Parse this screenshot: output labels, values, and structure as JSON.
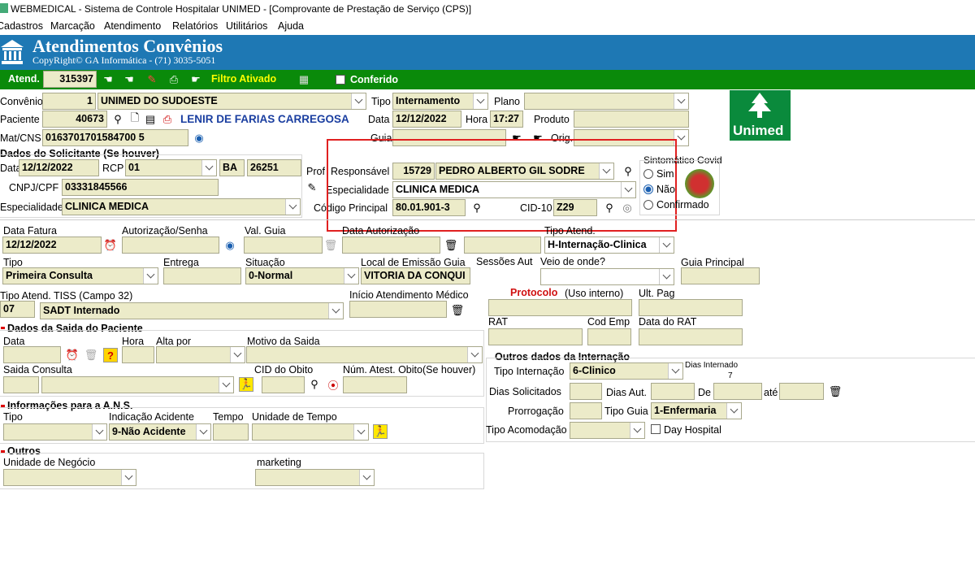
{
  "titlebar": {
    "title": "WEBMEDICAL - Sistema de Controle Hospitalar UNIMED - [Comprovante de Prestação de Serviço  (CPS)]"
  },
  "menu": [
    "Cadastros",
    "Marcação",
    "Atendimento",
    "Relatórios",
    "Utilitários",
    "Ajuda"
  ],
  "header": {
    "title": "Atendimentos Convênios",
    "copyright": "CopyRight© GA Informática - (71) 3035-5051",
    "bg": "#1e78b4"
  },
  "toolbar": {
    "atend_label": "Atend.",
    "atend_value": "315397",
    "filtro": "Filtro Ativado",
    "conferido": "Conferido",
    "bg": "#0a8a0a",
    "filtro_color": "#ffff00"
  },
  "patient": {
    "convenio_label": "Convênio",
    "convenio_code": "1",
    "convenio_name": "UNIMED DO SUDOESTE",
    "tipo_label": "Tipo",
    "tipo_value": "Internamento",
    "plano_label": "Plano",
    "paciente_label": "Paciente",
    "paciente_code": "40673",
    "paciente_name": "LENIR DE FARIAS CARREGOSA",
    "data_label": "Data",
    "data_value": "12/12/2022",
    "hora_label": "Hora",
    "hora_value": "17:27",
    "produto_label": "Produto",
    "matcns_label": "Mat/CNS",
    "matcns_value": "0163701701584700 5",
    "guia_label": "Guia",
    "orig_label": "Orig."
  },
  "solicitante": {
    "section": "Dados do Solicitante (Se houver)",
    "data_label": "Data",
    "data_value": "12/12/2022",
    "rcp_label": "RCP",
    "rcp_value": "01",
    "uf": "BA",
    "num": "26251",
    "cnpj_label": "CNPJ/CPF",
    "cnpj_value": "03331845566",
    "esp_label": "Especialidade",
    "esp_value": "CLINICA MEDICA"
  },
  "profissional": {
    "prof_label": "Prof",
    "resp_label": "Responsável",
    "resp_code": "15729",
    "resp_name": "PEDRO ALBERTO GIL SODRE",
    "esp_label": "Especialidade",
    "esp_value": "CLINICA MEDICA",
    "cod_label": "Código Principal",
    "cod_value": "80.01.901-3",
    "cid_label": "CID-10",
    "cid_value": "Z29"
  },
  "covid": {
    "title": "Sintomático Covid",
    "opts": [
      "Sim",
      "Não",
      "Confirmado"
    ],
    "selected": "Não"
  },
  "fatura": {
    "data_fatura_label": "Data Fatura",
    "data_fatura_value": "12/12/2022",
    "autorizacao_label": "Autorização/Senha",
    "val_guia_label": "Val. Guia",
    "data_aut_label": "Data Autorização",
    "tipo_atend_label": "Tipo Atend.",
    "tipo_atend_value": "H-Internação-Clinica",
    "tipo_label": "Tipo",
    "tipo_value": "Primeira Consulta",
    "entrega_label": "Entrega",
    "situacao_label": "Situação",
    "situacao_value": "0-Normal",
    "local_label": "Local de Emissão Guia",
    "local_value": "VITORIA DA CONQUI",
    "sessoes_label": "Sessões Aut",
    "veio_label": "Veio de onde?",
    "guia_principal_label": "Guia Principal",
    "tiss_label": "Tipo Atend. TISS (Campo 32)",
    "tiss_code": "07",
    "tiss_value": "SADT Internado",
    "inicio_label": "Início Atendimento Médico",
    "protocolo_label": "Protocolo",
    "protocolo_note": "(Uso interno)",
    "ult_pag_label": "Ult. Pag",
    "rat_label": "RAT",
    "cod_emp_label": "Cod Emp",
    "data_rat_label": "Data do RAT"
  },
  "saida": {
    "section": "Dados da Saida do Paciente",
    "data_label": "Data",
    "hora_label": "Hora",
    "alta_label": "Alta por",
    "motivo_label": "Motivo da Saida",
    "consulta_label": "Saida Consulta",
    "cid_obito_label": "CID do Obito",
    "atest_label": "Núm. Atest. Obito(Se houver)"
  },
  "ans": {
    "section": "Informações para a A.N.S.",
    "tipo_label": "Tipo",
    "indicacao_label": "Indicação Acidente",
    "indicacao_value": "9-Não Acidente",
    "tempo_label": "Tempo",
    "unidade_label": "Unidade de Tempo"
  },
  "outros": {
    "section": "Outros",
    "unidade_label": "Unidade de Negócio",
    "marketing_label": "marketing"
  },
  "internacao": {
    "section": "Outros dados da Internação",
    "tipo_label": "Tipo Internação",
    "tipo_value": "6-Clinico",
    "dias_internado_label": "Dias Internado",
    "dias_internado_value": "7",
    "dias_sol_label": "Dias Solicitados",
    "dias_aut_label": "Dias Aut.",
    "de_label": "De",
    "ate_label": "até",
    "prorrogacao_label": "Prorrogação",
    "tipo_guia_label": "Tipo Guia",
    "tipo_guia_value": "1-Enfermaria",
    "acomodacao_label": "Tipo Acomodação",
    "day_hospital": "Day Hospital"
  },
  "logo": {
    "text": "Unimed",
    "color": "#0a8a3c"
  },
  "highlight_color": "#e02020"
}
